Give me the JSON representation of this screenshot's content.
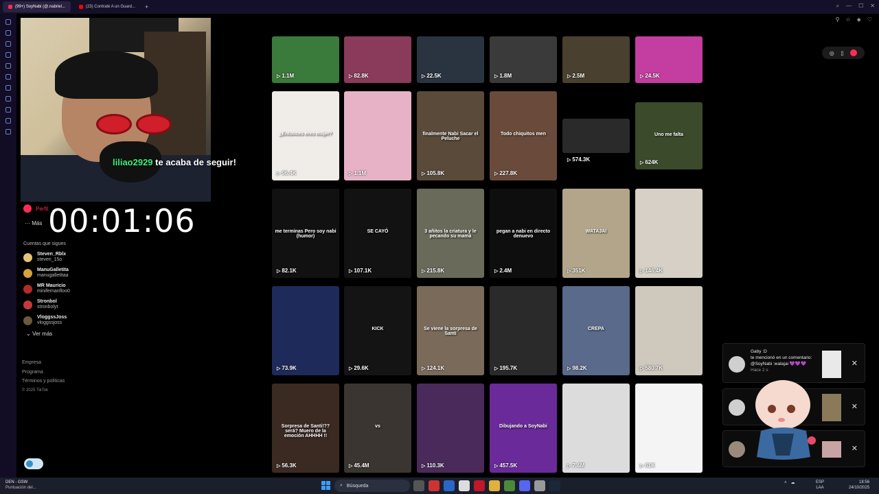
{
  "browser": {
    "tabs": [
      {
        "label": "(99+) SoyNabi (@.nabriel...",
        "color": "#fe2c55"
      },
      {
        "label": "(23) Contraté A un Guard...",
        "color": "#ff0000"
      }
    ],
    "add_tab": "+"
  },
  "stream_overlay": {
    "follow_user": "liliao2929",
    "follow_text": " te acaba de seguir!",
    "timer": "00:01:06"
  },
  "tiktok_nav": {
    "perfil": "Perfil",
    "mas": "Más"
  },
  "following": {
    "title": "Cuentas que sigues",
    "accounts": [
      {
        "name": "Steven_Rblx",
        "handle": "steven_15o",
        "color": "#e6c27a"
      },
      {
        "name": "ManuGalletita",
        "handle": "manugalletitaa",
        "color": "#d6a23c"
      },
      {
        "name": "MR Mauricio",
        "handle": "minifernanfloo0",
        "color": "#b22a2a"
      },
      {
        "name": "Stronbol",
        "handle": "stronbolyt",
        "color": "#c73a3a"
      },
      {
        "name": "VloggssJoss",
        "handle": "vloggssjoss",
        "color": "#6a5a3a"
      }
    ],
    "ver_mas": "Ver más"
  },
  "footer": {
    "links": [
      "Empresa",
      "Programa",
      "Términos y políticas"
    ],
    "copyright": "© 2025 TikTok"
  },
  "videos": [
    {
      "views": "1.1M",
      "caption": "",
      "bg": "#3a7a3a"
    },
    {
      "views": "82.8K",
      "caption": "",
      "bg": "#8a3a5a"
    },
    {
      "views": "22.5K",
      "caption": "",
      "bg": "#2a3440"
    },
    {
      "views": "1.8M",
      "caption": "",
      "bg": "#3a3a3a"
    },
    {
      "views": "2.5M",
      "caption": "",
      "bg": "#4a4030"
    },
    {
      "views": "24.5K",
      "caption": "",
      "bg": "#c43da0"
    },
    {
      "views": "96.4K",
      "caption": "¿Entonces eres mujer?",
      "bg": "#f0ede8"
    },
    {
      "views": "1.1M",
      "caption": "",
      "bg": "#e7b2c6"
    },
    {
      "views": "105.8K",
      "caption": "finalmente Nabi Sacar el Peluche",
      "bg": "#5a4a3a"
    },
    {
      "views": "227.8K",
      "caption": "Todo chiquitos men",
      "bg": "#6a4a3a"
    },
    {
      "views": "574.3K",
      "caption": "",
      "bg": "#2a2a2a"
    },
    {
      "views": "624K",
      "caption": "Uno me falta",
      "bg": "#3a4a2a"
    },
    {
      "views": "82.1K",
      "caption": "me terminas Pero soy nabi (humor)",
      "bg": "#111111"
    },
    {
      "views": "107.1K",
      "caption": "SE CAYÓ",
      "bg": "#121212"
    },
    {
      "views": "215.8K",
      "caption": "3 añitos la criatura y le pecando su mamá",
      "bg": "#6a6a5a"
    },
    {
      "views": "2.4M",
      "caption": "pegan a nabi en directo denuevo",
      "bg": "#0e0e0e"
    },
    {
      "views": "351K",
      "caption": "WATAJAI",
      "bg": "#b2a58a"
    },
    {
      "views": "146.4K",
      "caption": "",
      "bg": "#d6d0c6"
    },
    {
      "views": "73.9K",
      "caption": "",
      "bg": "#1e2a5a"
    },
    {
      "views": "29.6K",
      "caption": "KICK",
      "bg": "#141414"
    },
    {
      "views": "124.1K",
      "caption": "Se viene la sorpresa de Santi",
      "bg": "#7a6a5a"
    },
    {
      "views": "195.7K",
      "caption": "",
      "bg": "#2a2a2a"
    },
    {
      "views": "98.2K",
      "caption": "CREPA",
      "bg": "#5a6a8a"
    },
    {
      "views": "580.7K",
      "caption": "",
      "bg": "#cfc8bd"
    },
    {
      "views": "56.3K",
      "caption": "Sorpresa de Santi!?? será? Muero de la emoción AHHHH !!",
      "bg": "#3a2a22"
    },
    {
      "views": "45.4M",
      "caption": "vs",
      "bg": "#3a3530"
    },
    {
      "views": "110.3K",
      "caption": "",
      "bg": "#4a2a5a"
    },
    {
      "views": "457.5K",
      "caption": "Dibujando a SoyNabi",
      "bg": "#6a2a9a"
    },
    {
      "views": "7.4M",
      "caption": "",
      "bg": "#dcdcdc"
    },
    {
      "views": "61K",
      "caption": "",
      "bg": "#f4f4f4"
    }
  ],
  "notifications": [
    {
      "user": "Gaby :D",
      "text": "te mencionó en un comentario: @SoyNabi :watajai 💜💜💜",
      "time": "Hace 2 s"
    },
    {
      "user": "",
      "text": "",
      "time": ""
    },
    {
      "user": "",
      "text": "",
      "time": ""
    }
  ],
  "taskbar": {
    "weather_title": "DEN - GSW",
    "weather_sub": "Puntuación del...",
    "search": "Búsqueda",
    "lang1": "ESP",
    "lang2": "LAA",
    "time": "18:56",
    "date": "24/10/2025"
  }
}
